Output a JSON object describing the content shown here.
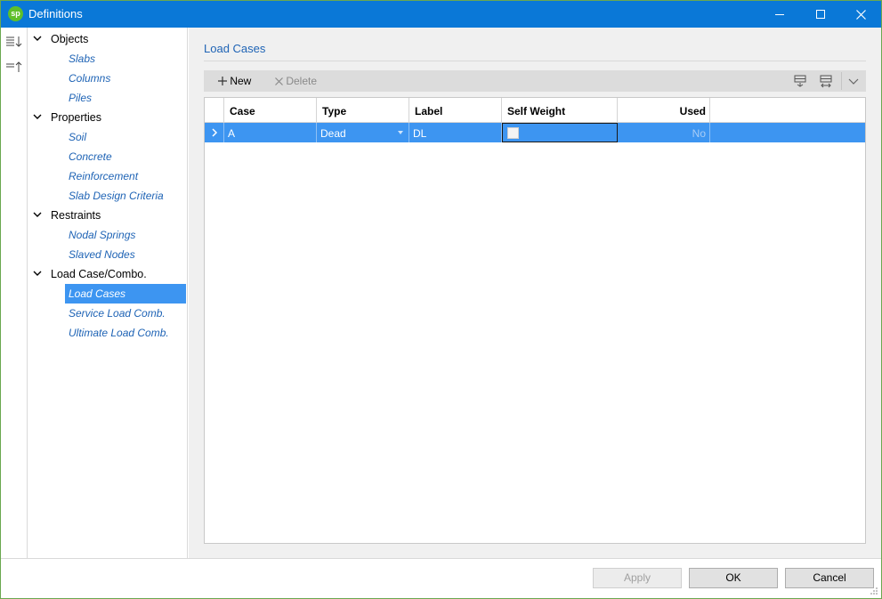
{
  "window": {
    "title": "Definitions",
    "app_icon_text": "sp",
    "accent": "#0a78d7"
  },
  "left_strip": {
    "icons": [
      "sort-descending-icon",
      "sort-ascending-icon"
    ]
  },
  "tree": {
    "groups": [
      {
        "label": "Objects",
        "items": [
          "Slabs",
          "Columns",
          "Piles"
        ]
      },
      {
        "label": "Properties",
        "items": [
          "Soil",
          "Concrete",
          "Reinforcement",
          "Slab Design Criteria"
        ]
      },
      {
        "label": "Restraints",
        "items": [
          "Nodal Springs",
          "Slaved Nodes"
        ]
      },
      {
        "label": "Load Case/Combo.",
        "items": [
          "Load Cases",
          "Service Load Comb.",
          "Ultimate Load Comb."
        ]
      }
    ],
    "selected": "Load Cases"
  },
  "main": {
    "section_title": "Load Cases",
    "toolbar": {
      "new_label": "New",
      "delete_label": "Delete"
    },
    "grid": {
      "columns": [
        "Case",
        "Type",
        "Label",
        "Self Weight",
        "Used"
      ],
      "rows": [
        {
          "case": "A",
          "type": "Dead",
          "label": "DL",
          "self_weight": false,
          "used": "No"
        }
      ]
    }
  },
  "footer": {
    "apply_label": "Apply",
    "ok_label": "OK",
    "cancel_label": "Cancel"
  },
  "colors": {
    "selection": "#3d95f1",
    "link": "#1e63b5",
    "app_icon": "#5fbf2a"
  }
}
